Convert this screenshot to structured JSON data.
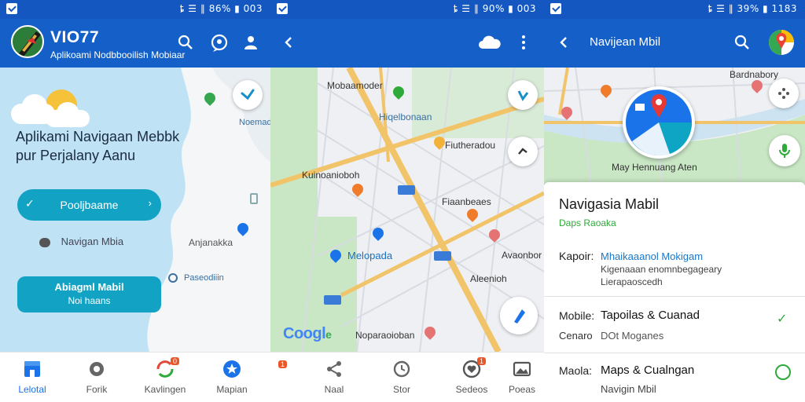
{
  "screen1": {
    "status_text": "ȶ ☰ ∥ 86% ▮ 003",
    "app_title": "VIO77",
    "app_subtitle": "Aplikoami Nodbbooilish Mobiaar",
    "headline_line1": "Aplikami Navigaan Mebbk",
    "headline_line2": "pur Perjalany Aanu",
    "primary_button_label": "Pooljbaame",
    "secondary_link_label": "Navigan Mbia",
    "cta_button_line1": "Abiagml Mabil",
    "cta_button_line2": "Noi haans",
    "map_labels": [
      "Noemad",
      "Anjanakka",
      "Paseodiiin"
    ],
    "bottom_nav": [
      "Lelotal",
      "Forik",
      "Kavlingen",
      "Mapian"
    ],
    "bottom_nav_badge": "0",
    "colors": {
      "primary": "#1560c8",
      "teal": "#12a3c4",
      "sea": "#bfe3f5"
    }
  },
  "screen2": {
    "status_text": "ȶ ☰ ∥ 90% ▮ 003",
    "map_labels": [
      "Mobaamoder",
      "Hiqelbonaan",
      "Fiutheradou",
      "Kuinoanioboh",
      "Fiaanbeaes",
      "Melopada",
      "Avaonbor",
      "Aleenioh",
      "Noparaoioban"
    ],
    "google_text": "Coogl",
    "google_suffix": "e",
    "bottom_nav": [
      "Naal",
      "Stor",
      "Sedeos",
      "Poeas"
    ],
    "bottom_nav_badge": "1"
  },
  "screen3": {
    "status_text": "ȶ ☰ ∥ 39% ▮ 1183",
    "app_title": "Navijean Mbil",
    "map_labels": [
      "Bardnabory",
      "May Hennuang Aten"
    ],
    "sheet_title": "Navigasia Mabil",
    "sheet_subtitle": "Daps Raoaka",
    "row1_label": "Kapoir:",
    "row1_link": "Mhaikaaanol Mokigam",
    "row1_desc_line1": "Kigenaaan enomnbegageary",
    "row1_desc_line2": "Lierapaoscedh",
    "row2_label": "Mobile:",
    "row2_title": "Tapoilas & Cuanad",
    "row2_sub_label": "Cenaro",
    "row2_sub_value": "DOt Moganes",
    "row3_label": "Maola:",
    "row3_title": "Maps & Cualngan",
    "row3_sub": "Navigin Mbil",
    "colors": {
      "green": "#2eaa3a",
      "link": "#1877c9"
    }
  }
}
